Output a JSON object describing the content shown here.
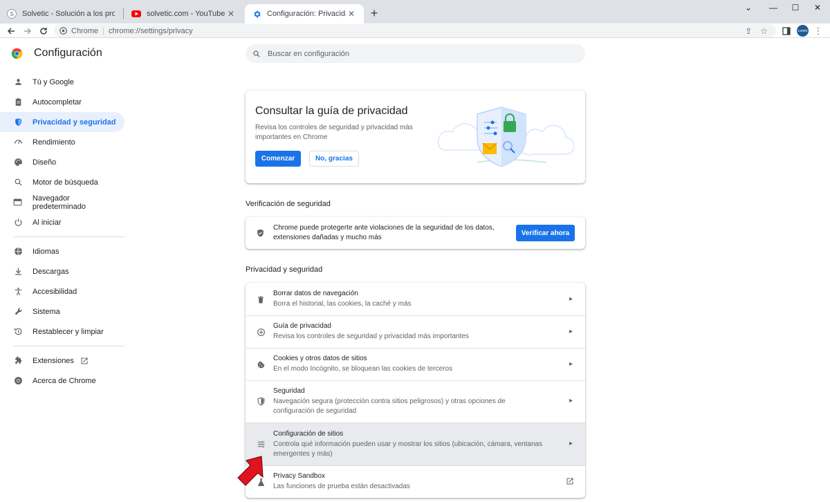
{
  "browser": {
    "tabs": [
      {
        "title": "Solvetic - Solución a los problem"
      },
      {
        "title": "solvetic.com - YouTube"
      },
      {
        "title": "Configuración: Privacidad y segu"
      }
    ],
    "site_label": "Chrome",
    "url": "chrome://settings/privacy",
    "avatar_text": "Lorem"
  },
  "app": {
    "title": "Configuración"
  },
  "search": {
    "placeholder": "Buscar en configuración"
  },
  "sidebar": {
    "items": [
      {
        "label": "Tú y Google",
        "icon": "person-icon"
      },
      {
        "label": "Autocompletar",
        "icon": "clipboard-icon"
      },
      {
        "label": "Privacidad y seguridad",
        "icon": "shield-icon",
        "active": true
      },
      {
        "label": "Rendimiento",
        "icon": "gauge-icon"
      },
      {
        "label": "Diseño",
        "icon": "palette-icon"
      },
      {
        "label": "Motor de búsqueda",
        "icon": "search-icon"
      },
      {
        "label": "Navegador predeterminado",
        "icon": "browser-icon"
      },
      {
        "label": "Al iniciar",
        "icon": "power-icon"
      },
      {
        "label": "Idiomas",
        "icon": "globe-icon"
      },
      {
        "label": "Descargas",
        "icon": "download-icon"
      },
      {
        "label": "Accesibilidad",
        "icon": "accessibility-icon"
      },
      {
        "label": "Sistema",
        "icon": "wrench-icon"
      },
      {
        "label": "Restablecer y limpiar",
        "icon": "history-icon"
      },
      {
        "label": "Extensiones",
        "icon": "puzzle-icon"
      },
      {
        "label": "Acerca de Chrome",
        "icon": "chrome-icon"
      }
    ]
  },
  "guide_card": {
    "title": "Consultar la guía de privacidad",
    "description": "Revisa los controles de seguridad y privacidad más importantes en Chrome",
    "start_label": "Comenzar",
    "decline_label": "No, gracias"
  },
  "safety": {
    "section_title": "Verificación de seguridad",
    "text": "Chrome puede protegerte ante violaciones de la seguridad de los datos, extensiones dañadas y mucho más",
    "button": "Verificar ahora"
  },
  "privacy": {
    "section_title": "Privacidad y seguridad",
    "rows": [
      {
        "title": "Borrar datos de navegación",
        "subtitle": "Borra el historial, las cookies, la caché y más"
      },
      {
        "title": "Guía de privacidad",
        "subtitle": "Revisa los controles de seguridad y privacidad más importantes"
      },
      {
        "title": "Cookies y otros datos de sitios",
        "subtitle": "En el modo Incógnito, se bloquean las cookies de terceros"
      },
      {
        "title": "Seguridad",
        "subtitle": "Navegación segura (protección contra sitios peligrosos) y otras opciones de configuración de seguridad"
      },
      {
        "title": "Configuración de sitios",
        "subtitle": "Controla qué información pueden usar y mostrar los sitios (ubicación, cámara, ventanas emergentes y más)"
      },
      {
        "title": "Privacy Sandbox",
        "subtitle": "Las funciones de prueba están desactivadas"
      }
    ]
  },
  "colors": {
    "accent": "#1a73e8",
    "active_nav_bg": "#e8f0fe",
    "annotation_arrow": "#e0131f"
  }
}
